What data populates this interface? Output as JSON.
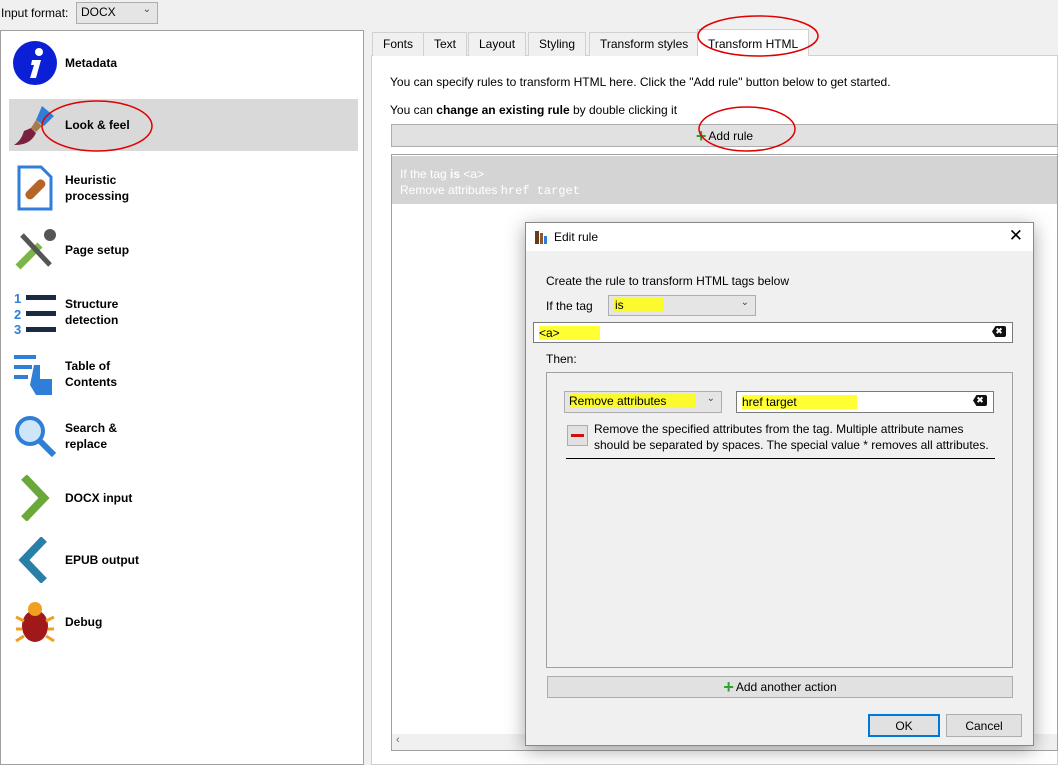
{
  "input_format": {
    "label": "Input format:",
    "value": "DOCX"
  },
  "sidebar": {
    "items": [
      {
        "label": "Metadata",
        "icon": "info-icon"
      },
      {
        "label": "Look & feel",
        "icon": "paintbrush-icon",
        "selected": true
      },
      {
        "label": "Heuristic processing",
        "icon": "bandage-document-icon"
      },
      {
        "label": "Page setup",
        "icon": "tools-icon"
      },
      {
        "label": "Structure detection",
        "icon": "numbered-list-icon"
      },
      {
        "label": "Table of Contents",
        "icon": "toc-hand-icon"
      },
      {
        "label": "Search & replace",
        "icon": "magnifier-icon"
      },
      {
        "label": "DOCX input",
        "icon": "chevron-right-icon"
      },
      {
        "label": "EPUB output",
        "icon": "chevron-left-icon"
      },
      {
        "label": "Debug",
        "icon": "bug-icon"
      }
    ]
  },
  "tabs": [
    {
      "label": "Fonts"
    },
    {
      "label": "Text"
    },
    {
      "label": "Layout"
    },
    {
      "label": "Styling"
    },
    {
      "label": "Transform styles"
    },
    {
      "label": "Transform HTML",
      "active": true
    }
  ],
  "main": {
    "intro": "You can specify rules to transform HTML here. Click the \"Add rule\" button below to get started.",
    "hint_pre": "You can ",
    "hint_bold": "change an existing rule",
    "hint_post": " by double clicking it",
    "add_rule": "Add rule",
    "rule": {
      "line1_pre": "If the tag ",
      "line1_bold": "is",
      "line1_post": " <a>",
      "line2_pre": "Remove attributes ",
      "line2_code": "href target"
    }
  },
  "dialog": {
    "title": "Edit rule",
    "intro": "Create the rule to transform HTML tags below",
    "if_label": "If the tag",
    "match_type": "is",
    "tag_value": "<a>",
    "then_label": "Then:",
    "action": "Remove attributes",
    "action_value": "href target",
    "action_desc": "Remove the specified attributes from the tag. Multiple attribute names should be separated by spaces. The special value * removes all attributes.",
    "add_action": "Add another action",
    "ok": "OK",
    "cancel": "Cancel"
  },
  "colors": {
    "selected_bg": "#d9d9d9",
    "accent_blue": "#0078d7",
    "annotation_red": "#e00000",
    "highlight_yellow": "#ffff00"
  }
}
